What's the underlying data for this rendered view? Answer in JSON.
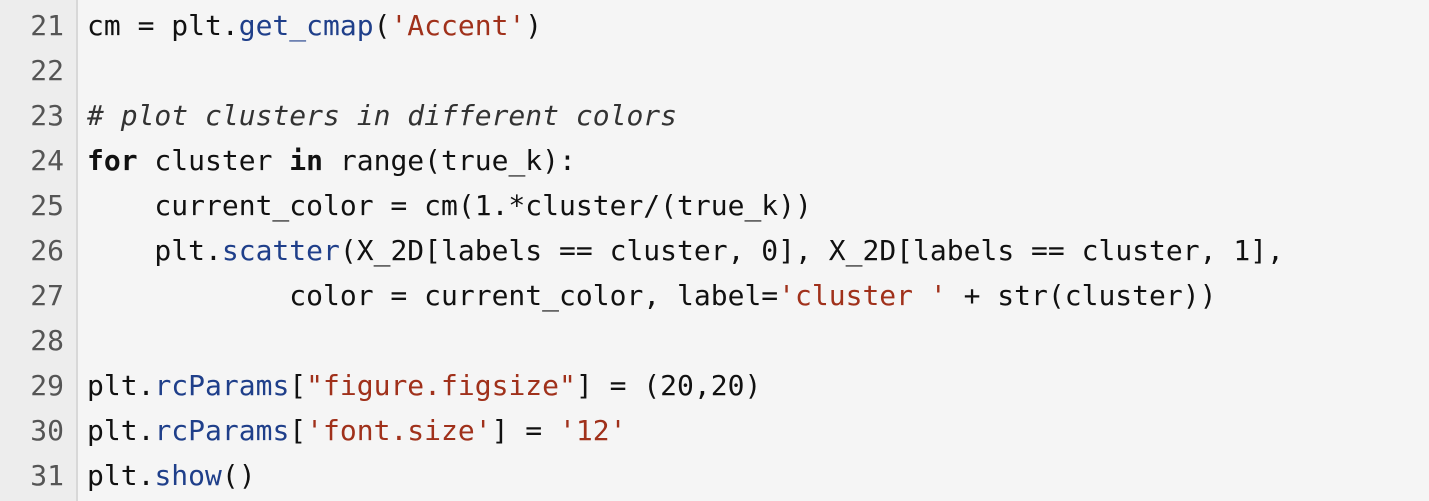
{
  "colors": {
    "background": "#f5f5f5",
    "gutter": "#ededed",
    "keyword": "#111111",
    "function": "#1f3f8a",
    "string": "#a0311b",
    "comment": "#333333",
    "plain": "#111111"
  },
  "lines": [
    {
      "number": "21",
      "tokens": [
        {
          "type": "plain",
          "text": "cm = plt."
        },
        {
          "type": "fn",
          "text": "get_cmap"
        },
        {
          "type": "plain",
          "text": "("
        },
        {
          "type": "str",
          "text": "'Accent'"
        },
        {
          "type": "plain",
          "text": ")"
        }
      ]
    },
    {
      "number": "22",
      "tokens": []
    },
    {
      "number": "23",
      "tokens": [
        {
          "type": "com",
          "text": "# plot clusters in different colors"
        }
      ]
    },
    {
      "number": "24",
      "tokens": [
        {
          "type": "kw",
          "text": "for"
        },
        {
          "type": "plain",
          "text": " cluster "
        },
        {
          "type": "kw",
          "text": "in"
        },
        {
          "type": "plain",
          "text": " range(true_k):"
        }
      ]
    },
    {
      "number": "25",
      "tokens": [
        {
          "type": "plain",
          "text": "    current_color = cm(1.*cluster/(true_k))"
        }
      ]
    },
    {
      "number": "26",
      "tokens": [
        {
          "type": "plain",
          "text": "    plt."
        },
        {
          "type": "fn",
          "text": "scatter"
        },
        {
          "type": "plain",
          "text": "(X_2D[labels == cluster, 0], X_2D[labels == cluster, 1],"
        }
      ]
    },
    {
      "number": "27",
      "tokens": [
        {
          "type": "plain",
          "text": "            color = current_color, label="
        },
        {
          "type": "str",
          "text": "'cluster '"
        },
        {
          "type": "plain",
          "text": " + str(cluster))"
        }
      ]
    },
    {
      "number": "28",
      "tokens": []
    },
    {
      "number": "29",
      "tokens": [
        {
          "type": "plain",
          "text": "plt."
        },
        {
          "type": "fn",
          "text": "rcParams"
        },
        {
          "type": "plain",
          "text": "["
        },
        {
          "type": "str",
          "text": "\"figure.figsize\""
        },
        {
          "type": "plain",
          "text": "] = (20,20)"
        }
      ]
    },
    {
      "number": "30",
      "tokens": [
        {
          "type": "plain",
          "text": "plt."
        },
        {
          "type": "fn",
          "text": "rcParams"
        },
        {
          "type": "plain",
          "text": "["
        },
        {
          "type": "str",
          "text": "'font.size'"
        },
        {
          "type": "plain",
          "text": "] = "
        },
        {
          "type": "str",
          "text": "'12'"
        }
      ]
    },
    {
      "number": "31",
      "tokens": [
        {
          "type": "plain",
          "text": "plt."
        },
        {
          "type": "fn",
          "text": "show"
        },
        {
          "type": "plain",
          "text": "()"
        }
      ]
    }
  ]
}
